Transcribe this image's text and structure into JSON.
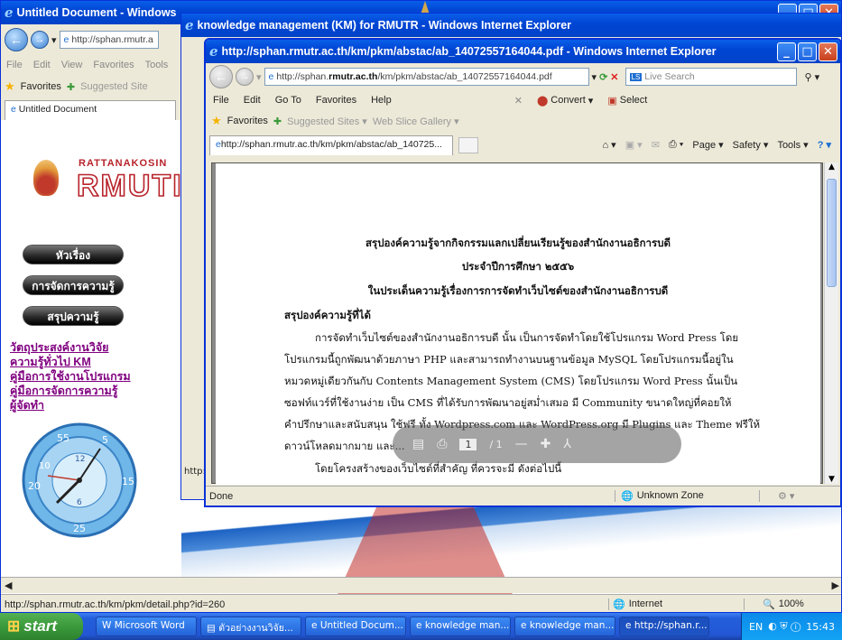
{
  "win_left": {
    "title": "Untitled Document - Windows",
    "address": "http://sphan.rmutr.a",
    "menu": [
      "File",
      "Edit",
      "View",
      "Favorites",
      "Tools"
    ],
    "favorites_label": "Favorites",
    "suggested": "Suggested Site",
    "tab": "Untitled Document",
    "logo_top": "RATTANAKOSIN",
    "logo_main": "RMUTI",
    "buttons": [
      "หัวเรื่อง",
      "การจัดการความรู้",
      "สรุปความรู้"
    ],
    "links": [
      "วัตถุประสงค์งานวิจัย",
      "ความรู้ทั่วไป KM",
      "คู่มือการใช้งานโปรแกรม",
      "คู่มือการจัดการความรู้",
      "ผู้จัดทำ"
    ],
    "clock_numbers": [
      "55",
      "5",
      "10",
      "15",
      "20",
      "25",
      "12",
      "6"
    ],
    "status": "http://sphan.rmutr.ac.th/km/pkm/detail.php?id=260",
    "status_zone": "Internet",
    "zoom": "100%"
  },
  "win_mid": {
    "title": "knowledge management (KM) for RMUTR - Windows Internet Explorer",
    "status_frag": "http:"
  },
  "win_front": {
    "title": "http://sphan.rmutr.ac.th/km/pkm/abstac/ab_14072557164044.pdf - Windows Internet Explorer",
    "address_pre": "http://sphan.",
    "address_bold": "rmutr.ac.th",
    "address_post": "/km/pkm/abstac/ab_14072557164044.pdf",
    "live_search": "Live Search",
    "menu": [
      "File",
      "Edit",
      "Go To",
      "Favorites",
      "Help"
    ],
    "convert": "Convert",
    "select": "Select",
    "favorites_label": "Favorites",
    "suggested": "Suggested Sites",
    "webslice": "Web Slice Gallery",
    "tab": "http://sphan.rmutr.ac.th/km/pkm/abstac/ab_140725...",
    "cmd": [
      "Page",
      "Safety",
      "Tools"
    ],
    "status_done": "Done",
    "status_zone": "Unknown Zone",
    "pdf_page": "1",
    "pdf_total": "1"
  },
  "doc": {
    "h1": "สรุปองค์ความรู้จากกิจกรรมแลกเปลี่ยนเรียนรู้ของสำนักงานอธิการบดี",
    "h2": "ประจำปีการศึกษา ๒๕๕๖",
    "h3": "ในประเด็นความรู้เรื่องการการจัดทำเว็บไซต์ของสำนักงานอธิการบดี",
    "section": "สรุปองค์ความรู้ที่ได้",
    "lines": [
      "การจัดทำเว็บไซต์ของสำนักงานอธิการบดี นั้น เป็นการจัดทำโดยใช้โปรแกรม Word Press โดย",
      "โปรแกรมนี้ถูกพัฒนาด้วยภาษา PHP และสามารถทำงานบนฐานข้อมูล MySQL โดยโปรแกรมนี้อยู่ใน",
      "หมวดหมู่เดียวกันกับ Contents Management System (CMS) โดยโปรแกรม Word Press นั้นเป็น",
      "ซอฟท์แวร์ที่ใช้งานง่าย เป็น CMS ที่ได้รับการพัฒนาอยู่สม่ำเสมอ มี Community ขนาดใหญ่ที่คอยให้",
      "คำปรึกษาและสนับสนุน ใช้ฟรี ทั้ง Wordpress.com และ WordPress.org มี Plugins และ Theme ฟรีให้",
      "ดาวน์โหลดมากมาย และ..."
    ],
    "last": "โดยโครงสร้างของเว็บไซต์ที่สำคัญ ที่ควรจะมี ดังต่อไปนี้"
  },
  "taskbar": {
    "start": "start",
    "items": [
      "Microsoft Word",
      "ตัวอย่างงานวิจัย...",
      "Untitled Docum...",
      "knowledge man...",
      "knowledge man...",
      "http://sphan.r..."
    ],
    "lang": "EN",
    "time": "15:43"
  }
}
